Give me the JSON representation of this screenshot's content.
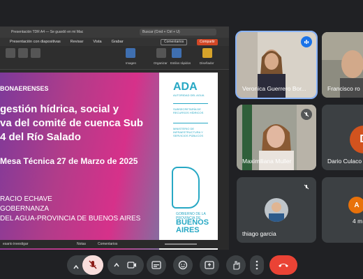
{
  "presentation": {
    "window_title": "Presentación TDR A4 — Se guardó en mi Mac",
    "search_placeholder": "Buscar (Cmd + Ctrl + U)",
    "menu": [
      "Presentación con diapositivas",
      "Revisar",
      "Vista",
      "Grabar"
    ],
    "comments_label": "Comentarios",
    "share_label": "Compartir",
    "ribbon_labels": [
      "Imagen",
      "Organizar",
      "Estilos rápidos",
      "Diseñador"
    ],
    "slide": {
      "kicker": "BONAERENSES",
      "title_lines": [
        "gestión hídrica, social y",
        "va del comité de cuenca Sub",
        "4 del Río Salado"
      ],
      "date_line": "Mesa Técnica 27 de Marzo de 2025",
      "speaker_lines": [
        "RACIO ECHAVE",
        "GOBERNANZA",
        "DEL AGUA-PROVINCIA DE BUENOS AIRES"
      ],
      "logo_text": "ADA",
      "logo_sub": "AUTORIDAD DEL AGUA",
      "side_blocks": [
        "SUBSECRETARÍA DE RECURSOS HÍDRICOS",
        "MINISTERIO DE INFRAESTRUCTURA Y SERVICIOS PÚBLICOS"
      ],
      "gob_text": "GOBIERNO DE LA PROVINCIA DE",
      "province_text": "BUENOS AIRES"
    },
    "statusbar": {
      "left": "esario investigar",
      "notes": "Notas",
      "comments": "Comentarios"
    }
  },
  "participants": [
    {
      "name": "Veronica Guerrero Bor...",
      "speaking": true
    },
    {
      "name": "Francisco ro"
    },
    {
      "name": "Maximiliana Muller",
      "muted": true
    },
    {
      "name": "Dario Culaco",
      "initial": "D"
    },
    {
      "name": "thiago garcia",
      "muted": true
    },
    {
      "name": "4 m",
      "initial": "A"
    }
  ],
  "controls": {
    "mic_state": "muted",
    "end_call_color": "#ea4335"
  }
}
